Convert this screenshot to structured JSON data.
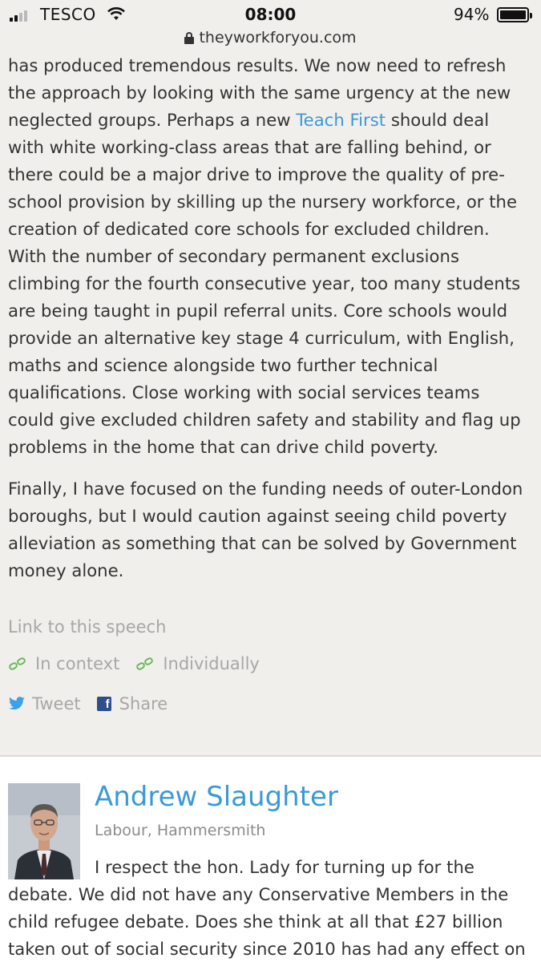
{
  "status_bar": {
    "carrier": "TESCO",
    "time": "08:00",
    "battery": "94%",
    "battery_level": 0.94,
    "url": "theyworkforyou.com"
  },
  "speech": {
    "paragraph1_before_link": "has produced tremendous results. We now need to refresh the approach by looking with the same urgency at the new neglected groups. Perhaps a new ",
    "link_text": "Teach First",
    "paragraph1_after_link": " should deal with white working-class areas that are falling behind, or there could be a major drive to improve the quality of pre-school provision by skilling up the nursery workforce, or the creation of dedicated core schools for excluded children. With the number of secondary permanent exclusions climbing for the fourth consecutive year, too many students are being taught in pupil referral units. Core schools would provide an alternative key stage 4 curriculum, with English, maths and science alongside two further technical qualifications. Close working with social services teams could give excluded children safety and stability and flag up problems in the home that can drive child poverty.",
    "paragraph2": "Finally, I have focused on the funding needs of outer-London boroughs, but I would caution against seeing child poverty alleviation as something that can be solved by Government money alone."
  },
  "speech_links": {
    "link_to_speech": "Link to this speech",
    "in_context": "In context",
    "individually": "Individually",
    "tweet": "Tweet",
    "share": "Share"
  },
  "next_speech": {
    "speaker": "Andrew Slaughter",
    "party": "Labour, Hammersmith",
    "text": "I respect the hon. Lady for turning up for the debate. We did not have any Conservative Members in the child refugee debate. Does she think at all that £27 billion taken out of social security since 2010 has had any effect on child"
  },
  "icons": [
    "lock-icon",
    "wifi-icon",
    "chain-link-icon",
    "twitter-icon",
    "facebook-icon"
  ]
}
